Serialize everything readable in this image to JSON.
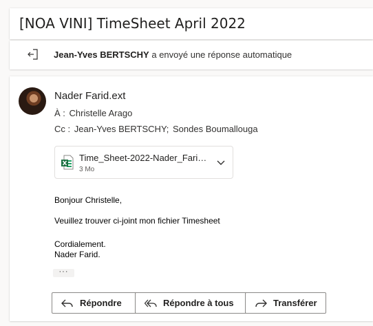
{
  "subject": "[NOA VINI] TimeSheet April 2022",
  "auto_reply": {
    "sender": "Jean-Yves BERTSCHY",
    "text": " a envoyé une réponse automatique"
  },
  "message": {
    "sender_name": "Nader Farid.ext",
    "to_label": "À :",
    "to": "Christelle Arago",
    "cc_label": "Cc :",
    "cc": [
      "Jean-Yves BERTSCHY;",
      "Sondes Boumallouga"
    ],
    "attachment": {
      "name": "Time_Sheet-2022-Nader_Farid.xlsx",
      "size": "3 Mo",
      "icon": "excel-file-icon"
    },
    "body": {
      "greeting": "Bonjour Christelle,",
      "line1": "Veuillez trouver ci-joint mon fichier Timesheet",
      "closing": "Cordialement.",
      "signature": "Nader Farid."
    },
    "ellipsis": "···"
  },
  "actions": {
    "reply": "Répondre",
    "reply_all": "Répondre à tous",
    "forward": "Transférer"
  },
  "colors": {
    "background": "#faf9f8",
    "card": "#ffffff",
    "excel_green": "#1d6f42",
    "border": "#8a8886"
  }
}
